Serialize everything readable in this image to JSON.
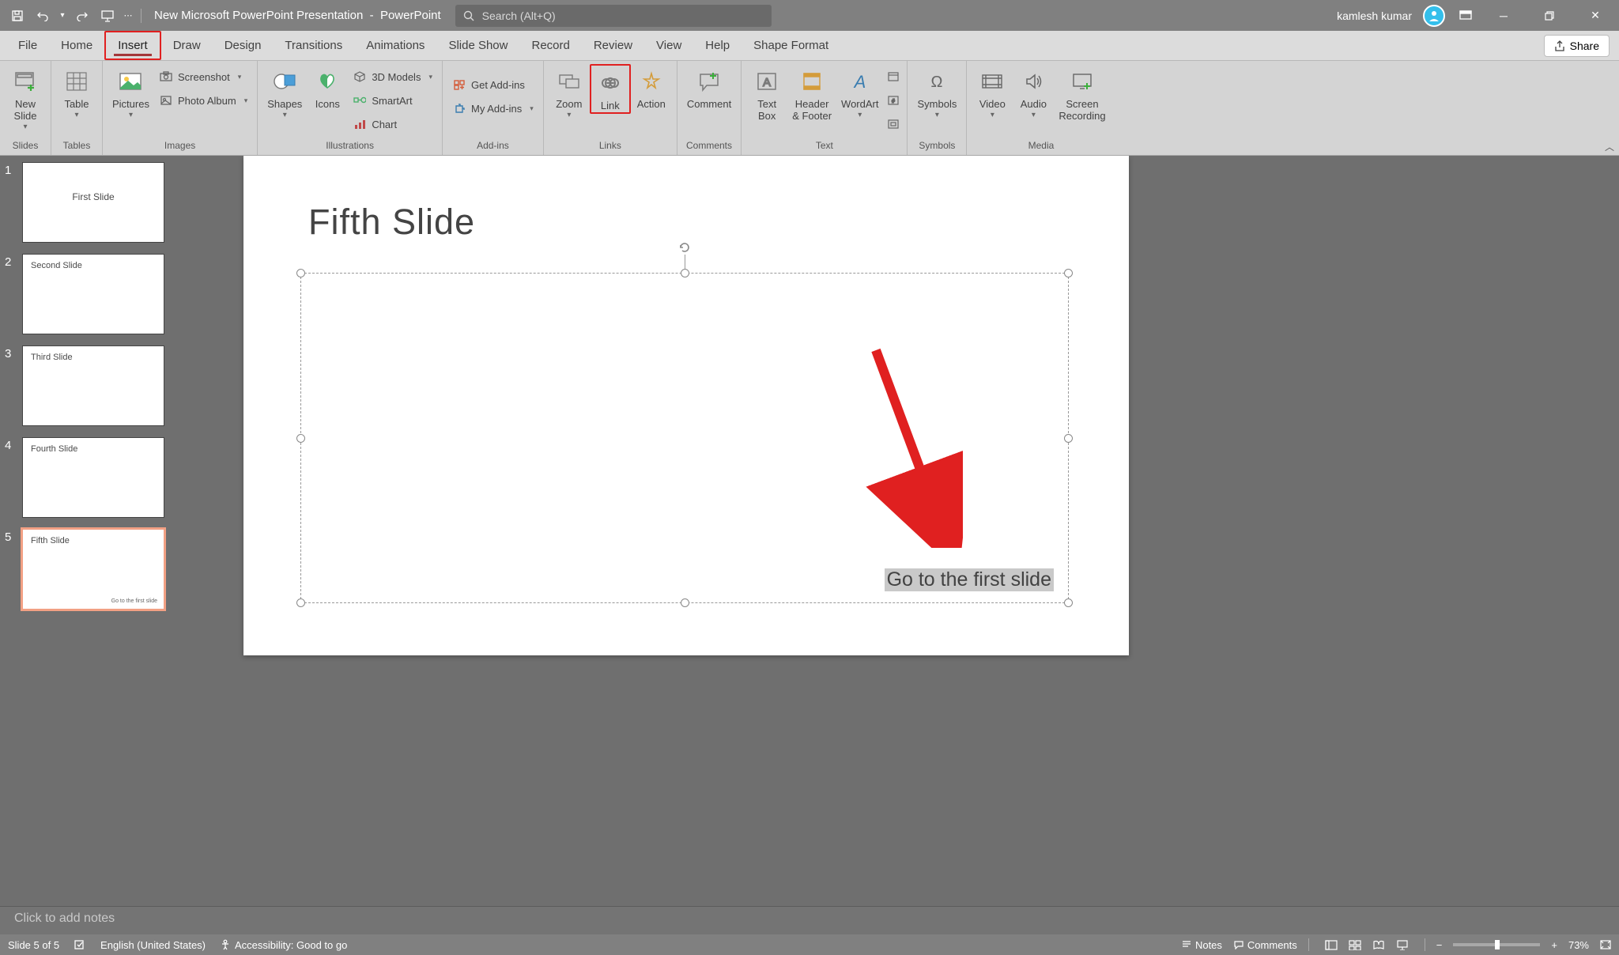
{
  "titlebar": {
    "document": "New Microsoft PowerPoint Presentation",
    "app": "PowerPoint",
    "search_placeholder": "Search (Alt+Q)",
    "user": "kamlesh kumar"
  },
  "tabs": {
    "file": "File",
    "home": "Home",
    "insert": "Insert",
    "draw": "Draw",
    "design": "Design",
    "transitions": "Transitions",
    "animations": "Animations",
    "slideshow": "Slide Show",
    "record": "Record",
    "review": "Review",
    "view": "View",
    "help": "Help",
    "shapeformat": "Shape Format",
    "share": "Share"
  },
  "ribbon": {
    "slides": {
      "label": "Slides",
      "new_slide": "New\nSlide"
    },
    "tables": {
      "label": "Tables",
      "table": "Table"
    },
    "images": {
      "label": "Images",
      "pictures": "Pictures",
      "screenshot": "Screenshot",
      "photo_album": "Photo Album"
    },
    "illustrations": {
      "label": "Illustrations",
      "shapes": "Shapes",
      "icons": "Icons",
      "models": "3D Models",
      "smartart": "SmartArt",
      "chart": "Chart"
    },
    "addins": {
      "label": "Add-ins",
      "get": "Get Add-ins",
      "my": "My Add-ins"
    },
    "links": {
      "label": "Links",
      "zoom": "Zoom",
      "link": "Link",
      "action": "Action"
    },
    "comments": {
      "label": "Comments",
      "comment": "Comment"
    },
    "text": {
      "label": "Text",
      "textbox": "Text\nBox",
      "header": "Header\n& Footer",
      "wordart": "WordArt"
    },
    "symbols": {
      "label": "Symbols",
      "symbols": "Symbols"
    },
    "media": {
      "label": "Media",
      "video": "Video",
      "audio": "Audio",
      "screen": "Screen\nRecording"
    }
  },
  "thumbs": [
    {
      "num": "1",
      "title": "First Slide",
      "center": true
    },
    {
      "num": "2",
      "title": "Second Slide"
    },
    {
      "num": "3",
      "title": "Third Slide"
    },
    {
      "num": "4",
      "title": "Fourth Slide"
    },
    {
      "num": "5",
      "title": "Fifth  Slide",
      "link": "Go to the first slide",
      "selected": true
    }
  ],
  "slide": {
    "title": "Fifth  Slide",
    "selected_text": "Go to the first slide"
  },
  "notes": {
    "placeholder": "Click to add notes"
  },
  "status": {
    "slide_of": "Slide 5 of 5",
    "language": "English (United States)",
    "accessibility": "Accessibility: Good to go",
    "notes": "Notes",
    "comments": "Comments",
    "zoom": "73%"
  }
}
